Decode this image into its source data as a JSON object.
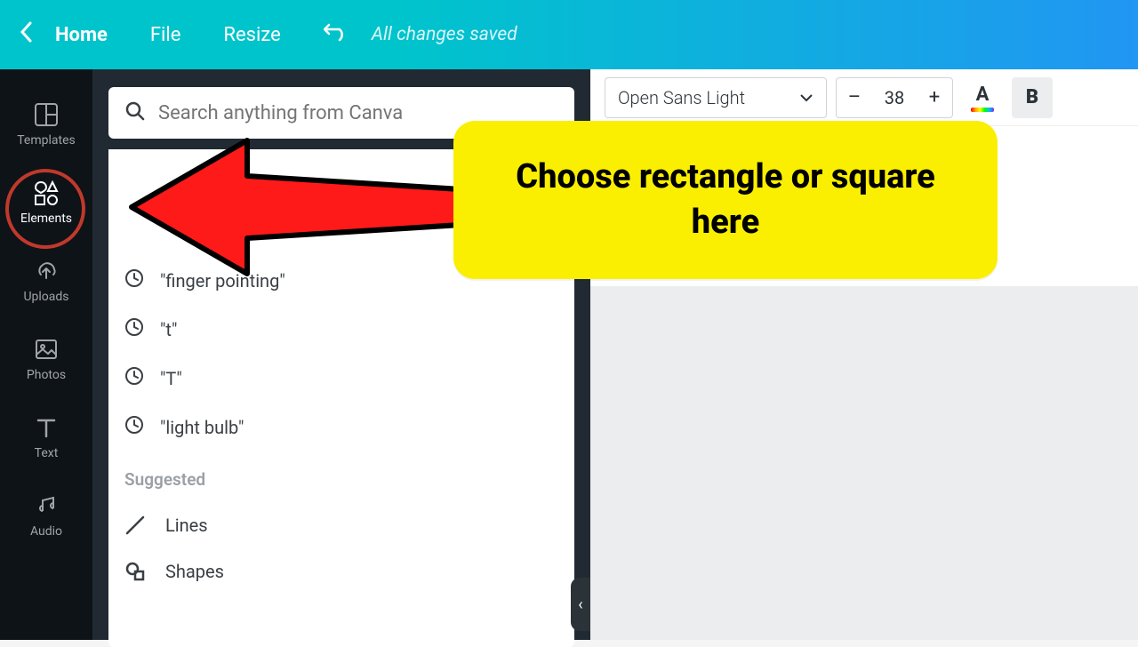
{
  "topbar": {
    "home": "Home",
    "file": "File",
    "resize": "Resize",
    "status": "All changes saved"
  },
  "sidebar": {
    "templates": "Templates",
    "elements": "Elements",
    "uploads": "Uploads",
    "photos": "Photos",
    "text": "Text",
    "audio": "Audio"
  },
  "search": {
    "placeholder": "Search anything from Canva"
  },
  "recent": [
    "\"finger pointing\"",
    "\"t\"",
    "\"T\"",
    "\"light bulb\""
  ],
  "suggested": {
    "heading": "Suggested",
    "lines": "Lines",
    "shapes": "Shapes"
  },
  "toolbar": {
    "font": "Open Sans Light",
    "dec": "–",
    "size": "38",
    "inc": "+",
    "color_letter": "A",
    "bold": "B"
  },
  "callout": "Choose rectangle or square here"
}
